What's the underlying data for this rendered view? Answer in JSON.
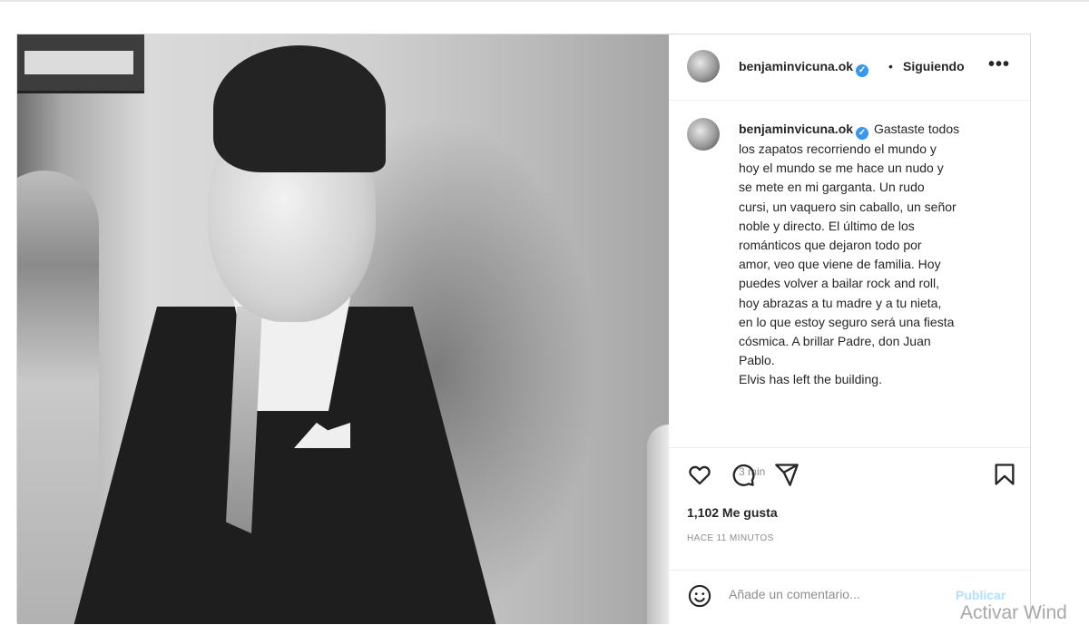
{
  "post": {
    "username": "benjaminvicuna.ok",
    "separator": "•",
    "follow_label": "Siguiendo",
    "more_label": "•••",
    "verified_mark": "✓",
    "caption_lines": [
      "Gastaste todos",
      "los zapatos recorriendo el mundo y",
      "hoy el mundo se me hace un nudo y",
      "se mete en mi garganta. Un rudo",
      "cursi, un vaquero sin caballo, un señor",
      "noble y directo. El último de los",
      "románticos que dejaron todo por",
      "amor, veo que viene de familia. Hoy",
      "puedes volver a bailar rock and roll,",
      "hoy abrazas a tu madre y a tu nieta,",
      "en lo que estoy seguro será una fiesta",
      "cósmica. A brillar Padre, don Juan",
      "Pablo.",
      "Elvis has left the building."
    ],
    "caption_time": "3 min",
    "likes": "1,102 Me gusta",
    "posted_ago": "HACE 11 MINUTOS",
    "comment_placeholder": "Añade un comentario...",
    "publish_label": "Publicar",
    "icons": [
      "heart-icon",
      "comment-icon",
      "share-icon",
      "bookmark-icon",
      "emoji-icon"
    ]
  },
  "watermark": "Activar Wind",
  "colors": {
    "verified": "#3897f0",
    "publish_disabled": "#b2dffc",
    "muted_text": "#8e8e8e"
  }
}
